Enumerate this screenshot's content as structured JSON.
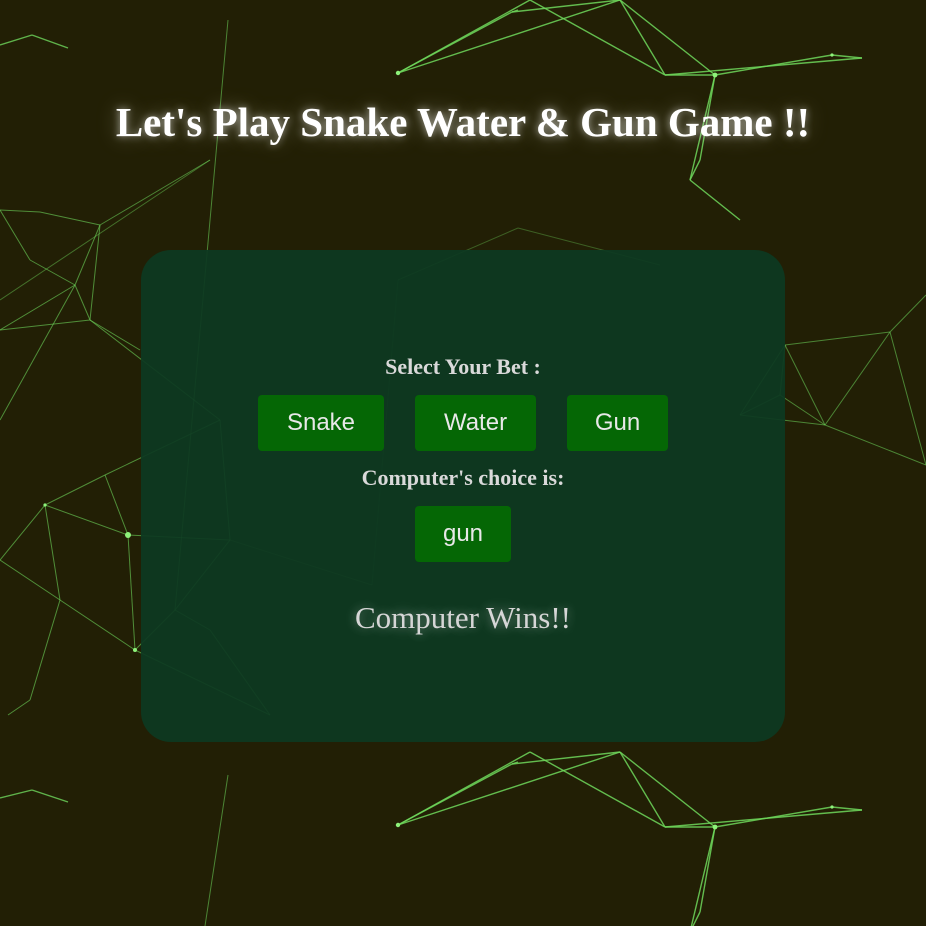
{
  "page": {
    "title": "Let's Play Snake Water & Gun Game !!"
  },
  "game": {
    "select_label": "Select Your Bet :",
    "options": [
      "Snake",
      "Water",
      "Gun"
    ],
    "computer_label": "Computer's choice is:",
    "computer_choice": "gun",
    "result": "Computer Wins!!"
  },
  "colors": {
    "background": "#221f05",
    "panel": "#0d3921",
    "button": "#056705",
    "network_lines": "#6fd85c",
    "title_text": "#ffffff"
  }
}
